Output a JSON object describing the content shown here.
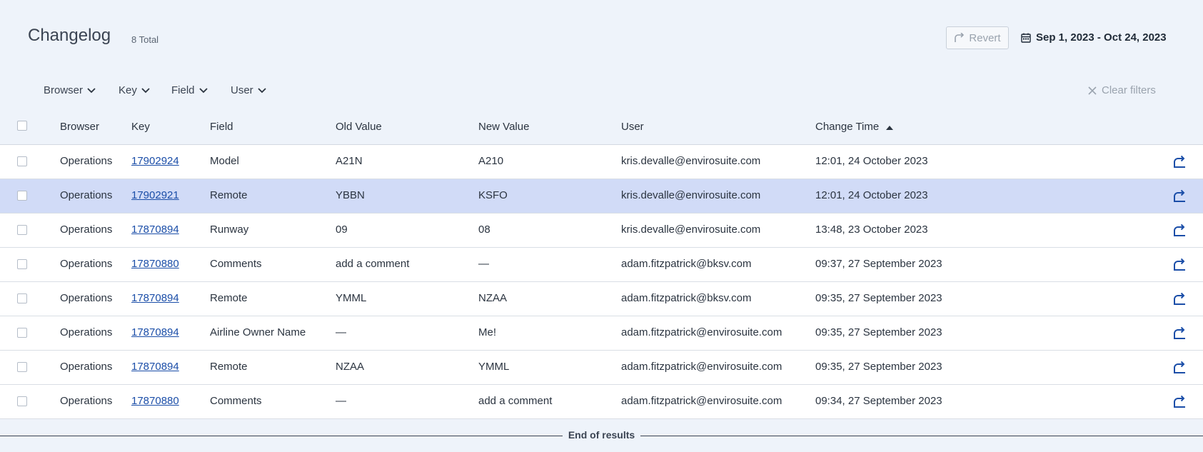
{
  "header": {
    "title": "Changelog",
    "total": "8 Total",
    "revert_label": "Revert",
    "date_range": "Sep 1, 2023 - Oct 24, 2023"
  },
  "filters": {
    "items": [
      "Browser",
      "Key",
      "Field",
      "User"
    ],
    "clear_label": "Clear filters"
  },
  "table": {
    "columns": [
      "Browser",
      "Key",
      "Field",
      "Old Value",
      "New Value",
      "User",
      "Change Time"
    ],
    "sort_column": "Change Time",
    "rows": [
      {
        "browser": "Operations",
        "key": "17902924",
        "field": "Model",
        "old": "A21N",
        "new": "A210",
        "user": "kris.devalle@envirosuite.com",
        "time": "12:01, 24 October 2023",
        "selected": false
      },
      {
        "browser": "Operations",
        "key": "17902921",
        "field": "Remote",
        "old": "YBBN",
        "new": "KSFO",
        "user": "kris.devalle@envirosuite.com",
        "time": "12:01, 24 October 2023",
        "selected": true
      },
      {
        "browser": "Operations",
        "key": "17870894",
        "field": "Runway",
        "old": "09",
        "new": "08",
        "user": "kris.devalle@envirosuite.com",
        "time": "13:48, 23 October 2023",
        "selected": false
      },
      {
        "browser": "Operations",
        "key": "17870880",
        "field": "Comments",
        "old": "add a comment",
        "new": "—",
        "user": "adam.fitzpatrick@bksv.com",
        "time": "09:37, 27 September 2023",
        "selected": false
      },
      {
        "browser": "Operations",
        "key": "17870894",
        "field": "Remote",
        "old": "YMML",
        "new": "NZAA",
        "user": "adam.fitzpatrick@bksv.com",
        "time": "09:35, 27 September 2023",
        "selected": false
      },
      {
        "browser": "Operations",
        "key": "17870894",
        "field": "Airline Owner Name",
        "old": "—",
        "new": "Me!",
        "user": "adam.fitzpatrick@envirosuite.com",
        "time": "09:35, 27 September 2023",
        "selected": false
      },
      {
        "browser": "Operations",
        "key": "17870894",
        "field": "Remote",
        "old": "NZAA",
        "new": "YMML",
        "user": "adam.fitzpatrick@envirosuite.com",
        "time": "09:35, 27 September 2023",
        "selected": false
      },
      {
        "browser": "Operations",
        "key": "17870880",
        "field": "Comments",
        "old": "—",
        "new": "add a comment",
        "user": "adam.fitzpatrick@envirosuite.com",
        "time": "09:34, 27 September 2023",
        "selected": false
      }
    ]
  },
  "footer": {
    "end_label": "End of results"
  },
  "icons": {
    "revert": "revert-icon",
    "calendar": "calendar-icon",
    "chevron": "chevron-down-icon",
    "clear": "close-icon",
    "sort": "sort-asc-icon",
    "row_action": "revert-row-icon"
  },
  "colors": {
    "link": "#1b4ea8",
    "selected_row": "#d1dbf7",
    "page_background": "#eef3fa"
  }
}
